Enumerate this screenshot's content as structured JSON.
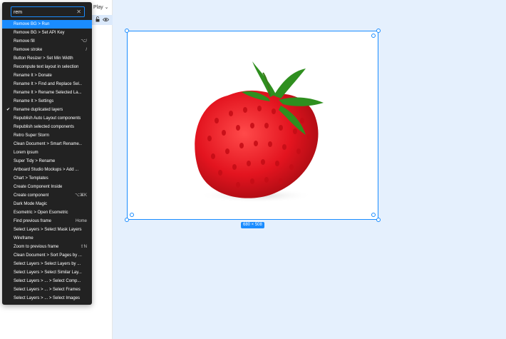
{
  "toolbar": {
    "play_label": "Play",
    "play_chevron": "⌄"
  },
  "canvas": {
    "frame_size_label": "680 × 508",
    "image_subject_icon": "strawberry-image"
  },
  "command_menu": {
    "search": {
      "value": "rem",
      "placeholder": "",
      "clear_icon": "✕"
    },
    "items": [
      {
        "label": "Remove BG > Run",
        "shortcut": "",
        "active": true,
        "checked": false
      },
      {
        "label": "Remove BG > Set API Key",
        "shortcut": "",
        "active": false,
        "checked": false
      },
      {
        "label": "Remove fill",
        "shortcut": "⌥/",
        "active": false,
        "checked": false
      },
      {
        "label": "Remove stroke",
        "shortcut": "/",
        "active": false,
        "checked": false
      },
      {
        "label": "Button Resizer > Set Min Width",
        "shortcut": "",
        "active": false,
        "checked": false
      },
      {
        "label": "Recompute text layout in selection",
        "shortcut": "",
        "active": false,
        "checked": false
      },
      {
        "label": "Rename It > Donate",
        "shortcut": "",
        "active": false,
        "checked": false
      },
      {
        "label": "Rename It > Find and Replace Sel...",
        "shortcut": "",
        "active": false,
        "checked": false
      },
      {
        "label": "Rename It > Rename Selected La...",
        "shortcut": "",
        "active": false,
        "checked": false
      },
      {
        "label": "Rename It > Settings",
        "shortcut": "",
        "active": false,
        "checked": false
      },
      {
        "label": "Rename duplicated layers",
        "shortcut": "",
        "active": false,
        "checked": true
      },
      {
        "label": "Republish Auto Layout components",
        "shortcut": "",
        "active": false,
        "checked": false
      },
      {
        "label": "Republish selected components",
        "shortcut": "",
        "active": false,
        "checked": false
      },
      {
        "label": "Retro Super Storm",
        "shortcut": "",
        "active": false,
        "checked": false
      },
      {
        "label": "Clean Document > Smart Rename...",
        "shortcut": "",
        "active": false,
        "checked": false
      },
      {
        "label": "Lorem ipsum",
        "shortcut": "",
        "active": false,
        "checked": false
      },
      {
        "label": "Super Tidy > Rename",
        "shortcut": "",
        "active": false,
        "checked": false
      },
      {
        "label": "Artboard Studio Mockups > Add ...",
        "shortcut": "",
        "active": false,
        "checked": false
      },
      {
        "label": "Chart > Templates",
        "shortcut": "",
        "active": false,
        "checked": false
      },
      {
        "label": "Create Component Inside",
        "shortcut": "",
        "active": false,
        "checked": false
      },
      {
        "label": "Create component",
        "shortcut": "⌥⌘K",
        "active": false,
        "checked": false
      },
      {
        "label": "Dark Mode Magic",
        "shortcut": "",
        "active": false,
        "checked": false
      },
      {
        "label": "Esometric > Open Esometric",
        "shortcut": "",
        "active": false,
        "checked": false
      },
      {
        "label": "Find previous frame",
        "shortcut": "Home",
        "active": false,
        "checked": false
      },
      {
        "label": "Select Layers > Select Mask Layers",
        "shortcut": "",
        "active": false,
        "checked": false
      },
      {
        "label": "Wireframe",
        "shortcut": "",
        "active": false,
        "checked": false
      },
      {
        "label": "Zoom to previous frame",
        "shortcut": "⇧N",
        "active": false,
        "checked": false
      },
      {
        "label": "Clean Document > Sort Pages by ...",
        "shortcut": "",
        "active": false,
        "checked": false
      },
      {
        "label": "Select Layers > Select Layers by ...",
        "shortcut": "",
        "active": false,
        "checked": false
      },
      {
        "label": "Select Layers > Select Similar Lay...",
        "shortcut": "",
        "active": false,
        "checked": false
      },
      {
        "label": "Select Layers > ... > Select Comp...",
        "shortcut": "",
        "active": false,
        "checked": false
      },
      {
        "label": "Select Layers > ... > Select Frames",
        "shortcut": "",
        "active": false,
        "checked": false
      },
      {
        "label": "Select Layers > ... > Select Images",
        "shortcut": "",
        "active": false,
        "checked": false
      }
    ]
  },
  "colors": {
    "accent": "#1a8cff",
    "menu_bg": "#222222",
    "canvas_bg": "#e5f0fd"
  }
}
